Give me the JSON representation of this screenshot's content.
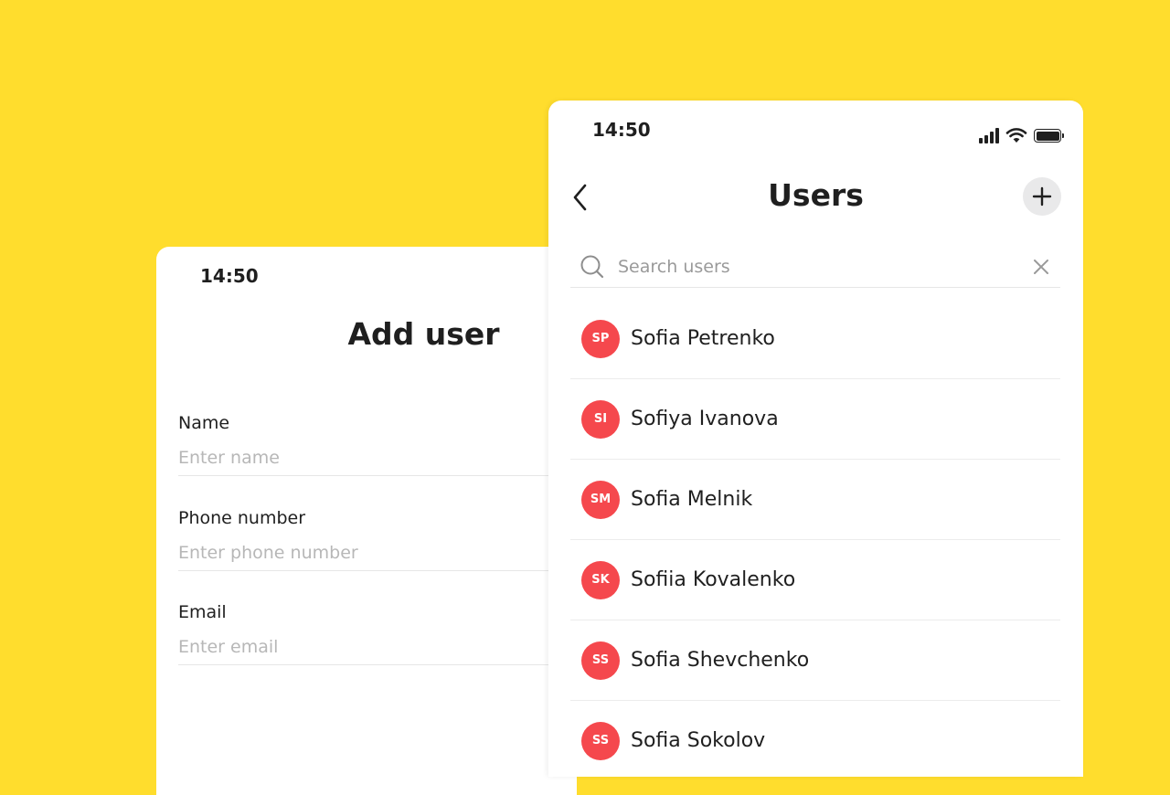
{
  "add_user_screen": {
    "status_time": "14:50",
    "title": "Add user",
    "fields": [
      {
        "label": "Name",
        "placeholder": "Enter name"
      },
      {
        "label": "Phone number",
        "placeholder": "Enter phone number"
      },
      {
        "label": "Email",
        "placeholder": "Enter email"
      }
    ]
  },
  "users_screen": {
    "status_time": "14:50",
    "title": "Users",
    "search": {
      "placeholder": "Search users",
      "value": ""
    },
    "users": [
      {
        "initials": "SP",
        "name": "Sofia Petrenko"
      },
      {
        "initials": "SI",
        "name": "Sofiya Ivanova"
      },
      {
        "initials": "SM",
        "name": "Sofia Melnik"
      },
      {
        "initials": "SK",
        "name": "Sofiia Kovalenko"
      },
      {
        "initials": "SS",
        "name": "Sofia Shevchenko"
      },
      {
        "initials": "SS",
        "name": "Sofia Sokolov"
      }
    ],
    "avatar_color": "#F5484D",
    "icons": {
      "back": "chevron-left-icon",
      "add": "plus-icon",
      "search": "search-icon",
      "clear": "close-icon",
      "signal": "cellular-signal-icon",
      "wifi": "wifi-icon",
      "battery": "battery-icon"
    }
  },
  "background_color": "#FFDD2D"
}
